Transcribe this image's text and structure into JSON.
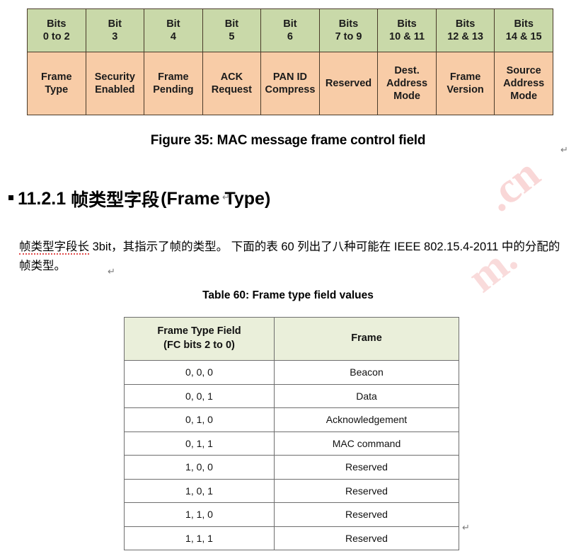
{
  "figure": {
    "caption": "Figure 35: MAC message frame control field",
    "colors": {
      "bits_row_bg": "#c9d9a9",
      "fields_row_bg": "#f8cca7",
      "border": "#4a3b2a"
    },
    "columns": [
      {
        "bits": "Bits\n0 to 2",
        "bits_line1": "Bits",
        "bits_line2": "0 to 2",
        "field_line1": "Frame",
        "field_line2": "Type",
        "field_line3": ""
      },
      {
        "bits_line1": "Bit",
        "bits_line2": "3",
        "field_line1": "Security",
        "field_line2": "Enabled",
        "field_line3": ""
      },
      {
        "bits_line1": "Bit",
        "bits_line2": "4",
        "field_line1": "Frame",
        "field_line2": "Pending",
        "field_line3": ""
      },
      {
        "bits_line1": "Bit",
        "bits_line2": "5",
        "field_line1": "ACK",
        "field_line2": "Request",
        "field_line3": ""
      },
      {
        "bits_line1": "Bit",
        "bits_line2": "6",
        "field_line1": "PAN ID",
        "field_line2": "Compress",
        "field_line3": ""
      },
      {
        "bits_line1": "Bits",
        "bits_line2": "7 to 9",
        "field_line1": "Reserved",
        "field_line2": "",
        "field_line3": ""
      },
      {
        "bits_line1": "Bits",
        "bits_line2": "10 & 11",
        "field_line1": "Dest.",
        "field_line2": "Address",
        "field_line3": "Mode"
      },
      {
        "bits_line1": "Bits",
        "bits_line2": "12 & 13",
        "field_line1": "Frame",
        "field_line2": "Version",
        "field_line3": ""
      },
      {
        "bits_line1": "Bits",
        "bits_line2": "14 & 15",
        "field_line1": "Source",
        "field_line2": "Address",
        "field_line3": "Mode"
      }
    ]
  },
  "heading": {
    "bullet": "square-bullet",
    "number": "11.2.1",
    "title_cn": "帧类型字段",
    "title_en": "(Frame Type)"
  },
  "paragraph": {
    "part1": "帧类型字段长",
    "part2": " 3bit，其指示了帧的类型。 下面的表 60 列出了八种可能在 IEEE 802.15.4-2011 中的分配的帧类型。"
  },
  "table60": {
    "caption": "Table 60: Frame type field values",
    "header": {
      "col1_line1": "Frame Type Field",
      "col1_line2": "(FC bits 2 to 0)",
      "col2": "Frame"
    },
    "rows": [
      {
        "bits": "0, 0, 0",
        "frame": "Beacon"
      },
      {
        "bits": "0, 0, 1",
        "frame": "Data"
      },
      {
        "bits": "0, 1, 0",
        "frame": "Acknowledgement"
      },
      {
        "bits": "0, 1, 1",
        "frame": "MAC command"
      },
      {
        "bits": "1, 0, 0",
        "frame": "Reserved"
      },
      {
        "bits": "1, 0, 1",
        "frame": "Reserved"
      },
      {
        "bits": "1, 1, 0",
        "frame": "Reserved"
      },
      {
        "bits": "1, 1, 1",
        "frame": "Reserved"
      }
    ]
  },
  "marks": {
    "return": "↵"
  },
  "watermarks": {
    "cn": ".cn",
    "m": "m.",
    "bottom": "cn"
  }
}
